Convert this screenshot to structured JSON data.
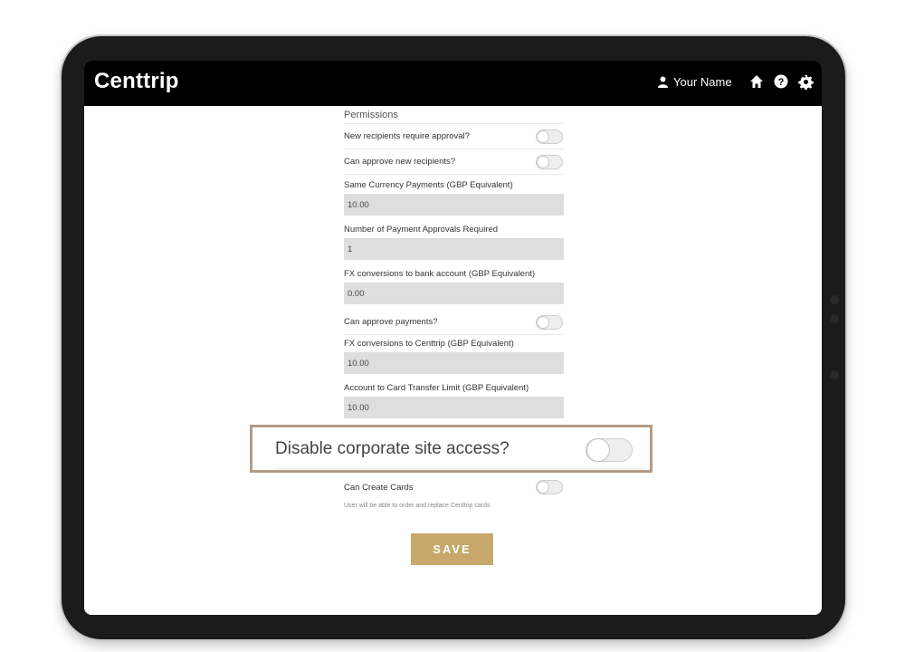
{
  "app": {
    "brand": "Centtrip"
  },
  "header": {
    "user_name": "Your Name"
  },
  "permissions": {
    "title": "Permissions",
    "new_recipients_label": "New recipients require approval?",
    "approve_recipients_label": "Can approve new recipients?",
    "same_currency_label": "Same Currency Payments (GBP Equivalent)",
    "same_currency_value": "10.00",
    "approvals_required_label": "Number of Payment Approvals Required",
    "approvals_required_value": "1",
    "fx_bank_label": "FX conversions to bank account (GBP Equivalent)",
    "fx_bank_value": "0.00",
    "approve_payments_label": "Can approve payments?",
    "fx_centtrip_label": "FX conversions to Centtrip (GBP Equivalent)",
    "fx_centtrip_value": "10.00",
    "card_transfer_label": "Account to Card Transfer Limit (GBP Equivalent)",
    "card_transfer_value": "10.00",
    "disable_access_label": "Disable corporate site access?",
    "create_cards_label": "Can Create Cards",
    "create_cards_hint": "User will be able to order and replace Centtrip cards"
  },
  "actions": {
    "save_label": "SAVE"
  },
  "colors": {
    "accent": "#c6a86a",
    "highlight_border": "#b49a86",
    "topbar": "#000000"
  }
}
